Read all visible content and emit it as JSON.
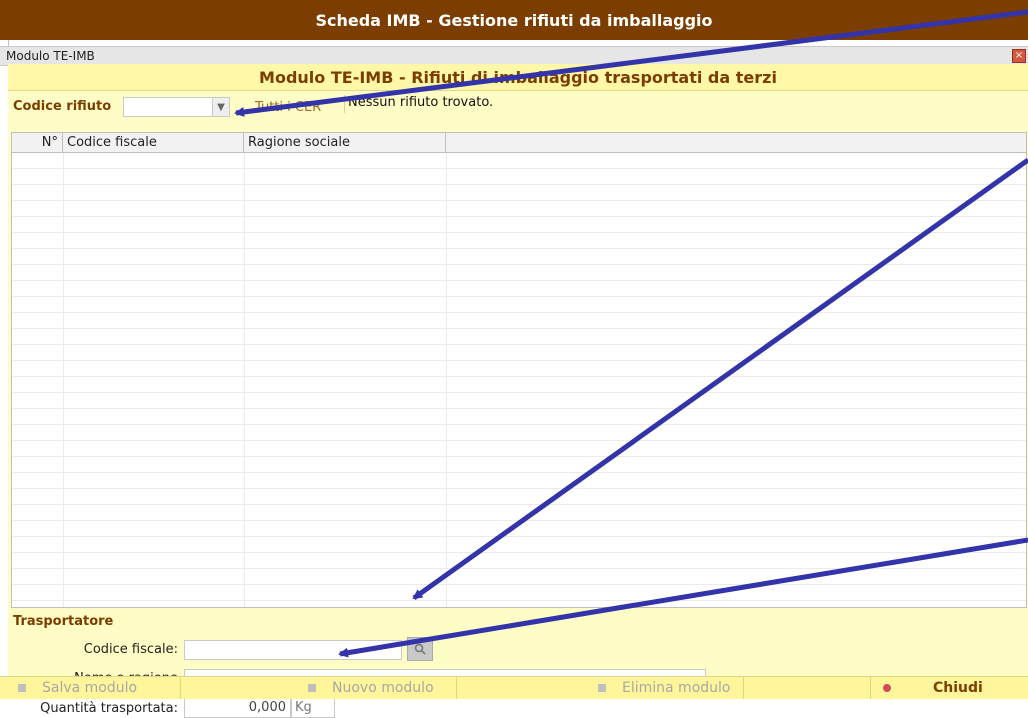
{
  "app": {
    "title": "Scheda IMB - Gestione rifiuti da imballaggio"
  },
  "window": {
    "title": "Modulo TE-IMB",
    "close_glyph": "×"
  },
  "panel": {
    "title": "Modulo TE-IMB - Rifiuti di imballaggio trasportati da terzi"
  },
  "filter": {
    "label": "Codice rifiuto",
    "selected_value": "",
    "tutti_link": "Tutti i CER",
    "message": "Nessun rifiuto trovato."
  },
  "table": {
    "columns": [
      "N°",
      "Codice fiscale",
      "Ragione sociale"
    ],
    "rows": []
  },
  "trasportatore": {
    "title": "Trasportatore",
    "codice_fiscale_label": "Codice fiscale:",
    "codice_fiscale_value": "",
    "nome_label": "Nome o ragione",
    "nome_value": "",
    "quantita_label": "Quantità trasportata:",
    "quantita_value": "0,000",
    "unit": "Kg"
  },
  "toolbar": {
    "salva": "Salva modulo",
    "nuovo": "Nuovo modulo",
    "elimina": "Elimina modulo",
    "chiudi": "Chiudi"
  },
  "icons": {
    "search": "search-icon",
    "close": "close-icon",
    "dropdown": "chevron-down-icon"
  },
  "colors": {
    "brand": "#7b3e00",
    "panel_bg": "#fffdc6",
    "toolbar_bg": "#fff69b",
    "annotation_arrow": "#3333aa"
  }
}
